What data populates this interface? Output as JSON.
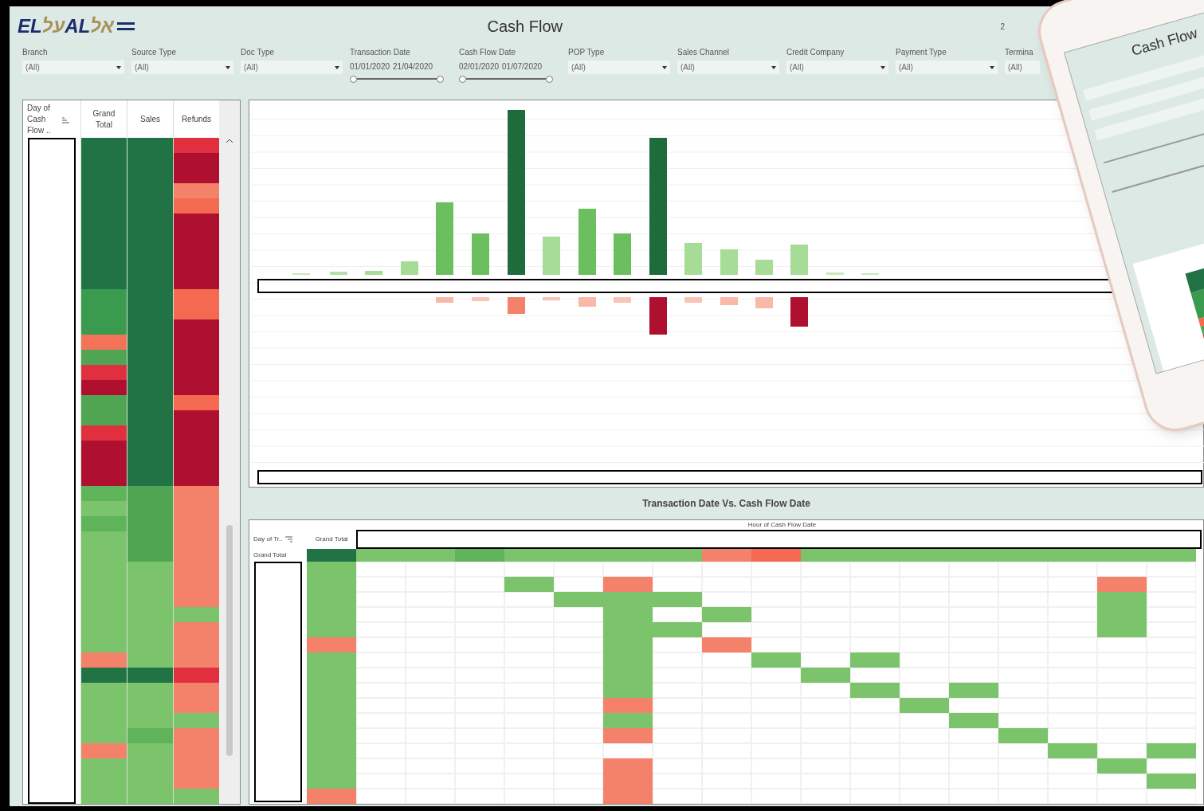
{
  "logo": {
    "latin_1": "EL",
    "hebrew_1": "על",
    "latin_2": "AL",
    "hebrew_2": "אל"
  },
  "title": "Cash Flow",
  "corner_text": "2",
  "filters": [
    {
      "kind": "dropdown",
      "label": "Branch",
      "value": "(All)"
    },
    {
      "kind": "dropdown",
      "label": "Source Type",
      "value": "(All)"
    },
    {
      "kind": "dropdown",
      "label": "Doc Type",
      "value": "(All)"
    },
    {
      "kind": "range",
      "label": "Transaction Date",
      "start": "01/01/2020",
      "end": "21/04/2020",
      "level": 1
    },
    {
      "kind": "range",
      "label": "Cash Flow Date",
      "start": "02/01/2020",
      "end": "01/07/2020",
      "level": 1
    },
    {
      "kind": "dropdown",
      "label": "POP Type",
      "value": "(All)"
    },
    {
      "kind": "dropdown",
      "label": "Sales Channel",
      "value": "(All)"
    },
    {
      "kind": "dropdown",
      "label": "Credit Company",
      "value": "(All)"
    },
    {
      "kind": "dropdown",
      "label": "Payment Type",
      "value": "(All)"
    },
    {
      "kind": "partial",
      "label": "Termina",
      "value": "(All)"
    }
  ],
  "day_table": {
    "columns": [
      "Day of Cash Flow ..",
      "Grand Total",
      "Sales",
      "Refunds"
    ],
    "rows": [
      {
        "cells": [
          {
            "color": "#217346"
          },
          {
            "color": "#217346"
          },
          {
            "color": "#e03040"
          }
        ]
      },
      {
        "cells": [
          {
            "color": "#217346"
          },
          {
            "color": "#217346"
          },
          {
            "color": "#b01030"
          }
        ]
      },
      {
        "cells": [
          {
            "color": "#217346"
          },
          {
            "color": "#217346"
          },
          {
            "color": "#b01030"
          }
        ]
      },
      {
        "cells": [
          {
            "color": "#217346"
          },
          {
            "color": "#217346"
          },
          {
            "color": "#f4826a"
          }
        ]
      },
      {
        "cells": [
          {
            "color": "#217346"
          },
          {
            "color": "#217346"
          },
          {
            "color": "#f46a50"
          }
        ]
      },
      {
        "cells": [
          {
            "color": "#217346"
          },
          {
            "color": "#217346"
          },
          {
            "color": "#b01030"
          }
        ]
      },
      {
        "cells": [
          {
            "color": "#217346"
          },
          {
            "color": "#217346"
          },
          {
            "color": "#b01030"
          }
        ]
      },
      {
        "cells": [
          {
            "color": "#217346"
          },
          {
            "color": "#217346"
          },
          {
            "color": "#b01030"
          }
        ]
      },
      {
        "cells": [
          {
            "color": "#217346"
          },
          {
            "color": "#217346"
          },
          {
            "color": "#b01030"
          }
        ]
      },
      {
        "cells": [
          {
            "color": "#217346"
          },
          {
            "color": "#217346"
          },
          {
            "color": "#b01030"
          }
        ]
      },
      {
        "cells": [
          {
            "color": "#3a9a4d"
          },
          {
            "color": "#217346"
          },
          {
            "color": "#f46a50"
          }
        ]
      },
      {
        "cells": [
          {
            "color": "#3a9a4d"
          },
          {
            "color": "#217346"
          },
          {
            "color": "#f46a50"
          }
        ]
      },
      {
        "cells": [
          {
            "color": "#3a9a4d"
          },
          {
            "color": "#217346"
          },
          {
            "color": "#b01030"
          }
        ]
      },
      {
        "cells": [
          {
            "color": "#f4715a"
          },
          {
            "color": "#217346"
          },
          {
            "color": "#b01030"
          }
        ]
      },
      {
        "cells": [
          {
            "color": "#4fa552"
          },
          {
            "color": "#217346"
          },
          {
            "color": "#b01030"
          }
        ]
      },
      {
        "cells": [
          {
            "color": "#e03040"
          },
          {
            "color": "#217346"
          },
          {
            "color": "#b01030"
          }
        ]
      },
      {
        "cells": [
          {
            "color": "#b01030"
          },
          {
            "color": "#217346"
          },
          {
            "color": "#b01030"
          }
        ]
      },
      {
        "cells": [
          {
            "color": "#4fa552"
          },
          {
            "color": "#217346"
          },
          {
            "color": "#f46a50"
          }
        ]
      },
      {
        "cells": [
          {
            "color": "#4fa552"
          },
          {
            "color": "#217346"
          },
          {
            "color": "#b01030"
          }
        ]
      },
      {
        "cells": [
          {
            "color": "#e03040"
          },
          {
            "color": "#217346"
          },
          {
            "color": "#b01030"
          }
        ]
      },
      {
        "cells": [
          {
            "color": "#b01030"
          },
          {
            "color": "#217346"
          },
          {
            "color": "#b01030"
          }
        ]
      },
      {
        "cells": [
          {
            "color": "#b01030"
          },
          {
            "color": "#217346"
          },
          {
            "color": "#b01030"
          }
        ]
      },
      {
        "cells": [
          {
            "color": "#b01030"
          },
          {
            "color": "#217346"
          },
          {
            "color": "#b01030"
          }
        ]
      },
      {
        "cells": [
          {
            "color": "#5fb35a"
          },
          {
            "color": "#4fa552"
          },
          {
            "color": "#f4826a"
          }
        ]
      },
      {
        "cells": [
          {
            "color": "#7cc46b"
          },
          {
            "color": "#4fa552"
          },
          {
            "color": "#f4826a"
          }
        ]
      },
      {
        "cells": [
          {
            "color": "#5fb35a"
          },
          {
            "color": "#4fa552"
          },
          {
            "color": "#f4826a"
          }
        ]
      },
      {
        "cells": [
          {
            "color": "#7cc46b"
          },
          {
            "color": "#4fa552"
          },
          {
            "color": "#f4826a"
          }
        ]
      },
      {
        "cells": [
          {
            "color": "#7cc46b"
          },
          {
            "color": "#4fa552"
          },
          {
            "color": "#f4826a"
          }
        ]
      },
      {
        "cells": [
          {
            "color": "#7cc46b"
          },
          {
            "color": "#7cc46b"
          },
          {
            "color": "#f4826a"
          }
        ]
      },
      {
        "cells": [
          {
            "color": "#7cc46b"
          },
          {
            "color": "#7cc46b"
          },
          {
            "color": "#f4826a"
          }
        ]
      },
      {
        "cells": [
          {
            "color": "#7cc46b"
          },
          {
            "color": "#7cc46b"
          },
          {
            "color": "#f4826a"
          }
        ]
      },
      {
        "cells": [
          {
            "color": "#7cc46b"
          },
          {
            "color": "#7cc46b"
          },
          {
            "color": "#7cc46b"
          }
        ]
      },
      {
        "cells": [
          {
            "color": "#7cc46b"
          },
          {
            "color": "#7cc46b"
          },
          {
            "color": "#f4826a"
          }
        ]
      },
      {
        "cells": [
          {
            "color": "#7cc46b"
          },
          {
            "color": "#7cc46b"
          },
          {
            "color": "#f4826a"
          }
        ]
      },
      {
        "cells": [
          {
            "color": "#f4826a"
          },
          {
            "color": "#7cc46b"
          },
          {
            "color": "#f4826a"
          }
        ]
      },
      {
        "cells": [
          {
            "color": "#217346"
          },
          {
            "color": "#217346"
          },
          {
            "color": "#e03040"
          }
        ]
      },
      {
        "cells": [
          {
            "color": "#7cc46b"
          },
          {
            "color": "#7cc46b"
          },
          {
            "color": "#f4826a"
          }
        ]
      },
      {
        "cells": [
          {
            "color": "#7cc46b"
          },
          {
            "color": "#7cc46b"
          },
          {
            "color": "#f4826a"
          }
        ]
      },
      {
        "cells": [
          {
            "color": "#7cc46b"
          },
          {
            "color": "#7cc46b"
          },
          {
            "color": "#7cc46b"
          }
        ]
      },
      {
        "cells": [
          {
            "color": "#7cc46b"
          },
          {
            "color": "#5fb35a"
          },
          {
            "color": "#f4826a"
          }
        ]
      },
      {
        "cells": [
          {
            "color": "#f4826a"
          },
          {
            "color": "#7cc46b"
          },
          {
            "color": "#f4826a"
          }
        ]
      },
      {
        "cells": [
          {
            "color": "#7cc46b"
          },
          {
            "color": "#7cc46b"
          },
          {
            "color": "#f4826a"
          }
        ]
      },
      {
        "cells": [
          {
            "color": "#7cc46b"
          },
          {
            "color": "#7cc46b"
          },
          {
            "color": "#f4826a"
          }
        ]
      },
      {
        "cells": [
          {
            "color": "#7cc46b"
          },
          {
            "color": "#7cc46b"
          },
          {
            "color": "#7cc46b"
          }
        ]
      }
    ]
  },
  "matrix": {
    "title": "Transaction Date Vs. Cash Flow Date",
    "row_header": "Day of Tr..",
    "total_header": "Grand Total",
    "column_header": "Hour of Cash Flow Date",
    "total_row_label": "Grand Total",
    "total_row": {
      "total": {
        "color": "#217346"
      },
      "cells": [
        {
          "filled": true,
          "color": "#7cc46b"
        },
        {
          "filled": true,
          "color": "#7cc46b"
        },
        {
          "filled": true,
          "color": "#5fb35a"
        },
        {
          "filled": true,
          "color": "#7cc46b"
        },
        {
          "filled": true,
          "color": "#7cc46b"
        },
        {
          "filled": true,
          "color": "#7cc46b"
        },
        {
          "filled": true,
          "color": "#7cc46b"
        },
        {
          "filled": true,
          "color": "#f4826a"
        },
        {
          "filled": true,
          "color": "#f46a50"
        },
        {
          "filled": true,
          "color": "#7cc46b"
        },
        {
          "filled": true,
          "color": "#7cc46b"
        },
        {
          "filled": true,
          "color": "#7cc46b"
        },
        {
          "filled": true,
          "color": "#7cc46b"
        },
        {
          "filled": true,
          "color": "#7cc46b"
        },
        {
          "filled": true,
          "color": "#7cc46b"
        },
        {
          "filled": true,
          "color": "#7cc46b"
        },
        {
          "filled": true,
          "color": "#7cc46b"
        }
      ]
    },
    "rows": [
      {
        "total": {
          "color": "#7cc46b"
        },
        "cells": [
          {
            "filled": false
          },
          {
            "filled": false
          },
          {
            "filled": false
          },
          {
            "filled": false
          },
          {
            "filled": false
          },
          {
            "filled": false
          },
          {
            "filled": false
          },
          {
            "filled": false
          },
          {
            "filled": false
          },
          {
            "filled": false
          },
          {
            "filled": false
          },
          {
            "filled": false
          },
          {
            "filled": false
          },
          {
            "filled": false
          },
          {
            "filled": false
          },
          {
            "filled": false
          },
          {
            "filled": false
          }
        ]
      },
      {
        "total": {
          "color": "#7cc46b"
        },
        "cells": [
          {
            "filled": false
          },
          {
            "filled": false
          },
          {
            "filled": false
          },
          {
            "filled": true,
            "color": "#7cc46b"
          },
          {
            "filled": false
          },
          {
            "filled": true,
            "color": "#f4826a"
          },
          {
            "filled": false
          },
          {
            "filled": false
          },
          {
            "filled": false
          },
          {
            "filled": false
          },
          {
            "filled": false
          },
          {
            "filled": false
          },
          {
            "filled": false
          },
          {
            "filled": false
          },
          {
            "filled": false
          },
          {
            "filled": true,
            "color": "#f4826a"
          },
          {
            "filled": false
          }
        ]
      },
      {
        "total": {
          "color": "#7cc46b"
        },
        "cells": [
          {
            "filled": false
          },
          {
            "filled": false
          },
          {
            "filled": false
          },
          {
            "filled": false
          },
          {
            "filled": true,
            "color": "#7cc46b"
          },
          {
            "filled": true,
            "color": "#7cc46b"
          },
          {
            "filled": true,
            "color": "#7cc46b"
          },
          {
            "filled": false
          },
          {
            "filled": false
          },
          {
            "filled": false
          },
          {
            "filled": false
          },
          {
            "filled": false
          },
          {
            "filled": false
          },
          {
            "filled": false
          },
          {
            "filled": false
          },
          {
            "filled": true,
            "color": "#7cc46b"
          },
          {
            "filled": false
          }
        ]
      },
      {
        "total": {
          "color": "#7cc46b"
        },
        "cells": [
          {
            "filled": false
          },
          {
            "filled": false
          },
          {
            "filled": false
          },
          {
            "filled": false
          },
          {
            "filled": false
          },
          {
            "filled": true,
            "color": "#7cc46b"
          },
          {
            "filled": false
          },
          {
            "filled": true,
            "color": "#7cc46b"
          },
          {
            "filled": false
          },
          {
            "filled": false
          },
          {
            "filled": false
          },
          {
            "filled": false
          },
          {
            "filled": false
          },
          {
            "filled": false
          },
          {
            "filled": false
          },
          {
            "filled": true,
            "color": "#7cc46b"
          },
          {
            "filled": false
          }
        ]
      },
      {
        "total": {
          "color": "#7cc46b"
        },
        "cells": [
          {
            "filled": false
          },
          {
            "filled": false
          },
          {
            "filled": false
          },
          {
            "filled": false
          },
          {
            "filled": false
          },
          {
            "filled": true,
            "color": "#7cc46b"
          },
          {
            "filled": true,
            "color": "#7cc46b"
          },
          {
            "filled": false
          },
          {
            "filled": false
          },
          {
            "filled": false
          },
          {
            "filled": false
          },
          {
            "filled": false
          },
          {
            "filled": false
          },
          {
            "filled": false
          },
          {
            "filled": false
          },
          {
            "filled": true,
            "color": "#7cc46b"
          },
          {
            "filled": false
          }
        ]
      },
      {
        "total": {
          "color": "#f4826a"
        },
        "cells": [
          {
            "filled": false
          },
          {
            "filled": false
          },
          {
            "filled": false
          },
          {
            "filled": false
          },
          {
            "filled": false
          },
          {
            "filled": true,
            "color": "#7cc46b"
          },
          {
            "filled": false
          },
          {
            "filled": true,
            "color": "#f4826a"
          },
          {
            "filled": false
          },
          {
            "filled": false
          },
          {
            "filled": false
          },
          {
            "filled": false
          },
          {
            "filled": false
          },
          {
            "filled": false
          },
          {
            "filled": false
          },
          {
            "filled": false
          },
          {
            "filled": false
          }
        ]
      },
      {
        "total": {
          "color": "#7cc46b"
        },
        "cells": [
          {
            "filled": false
          },
          {
            "filled": false
          },
          {
            "filled": false
          },
          {
            "filled": false
          },
          {
            "filled": false
          },
          {
            "filled": true,
            "color": "#7cc46b"
          },
          {
            "filled": false
          },
          {
            "filled": false
          },
          {
            "filled": true,
            "color": "#7cc46b"
          },
          {
            "filled": false
          },
          {
            "filled": true,
            "color": "#7cc46b"
          },
          {
            "filled": false
          },
          {
            "filled": false
          },
          {
            "filled": false
          },
          {
            "filled": false
          },
          {
            "filled": false
          },
          {
            "filled": false
          }
        ]
      },
      {
        "total": {
          "color": "#7cc46b"
        },
        "cells": [
          {
            "filled": false
          },
          {
            "filled": false
          },
          {
            "filled": false
          },
          {
            "filled": false
          },
          {
            "filled": false
          },
          {
            "filled": true,
            "color": "#7cc46b"
          },
          {
            "filled": false
          },
          {
            "filled": false
          },
          {
            "filled": false
          },
          {
            "filled": true,
            "color": "#7cc46b"
          },
          {
            "filled": false
          },
          {
            "filled": false
          },
          {
            "filled": false
          },
          {
            "filled": false
          },
          {
            "filled": false
          },
          {
            "filled": false
          },
          {
            "filled": false
          }
        ]
      },
      {
        "total": {
          "color": "#7cc46b"
        },
        "cells": [
          {
            "filled": false
          },
          {
            "filled": false
          },
          {
            "filled": false
          },
          {
            "filled": false
          },
          {
            "filled": false
          },
          {
            "filled": true,
            "color": "#7cc46b"
          },
          {
            "filled": false
          },
          {
            "filled": false
          },
          {
            "filled": false
          },
          {
            "filled": false
          },
          {
            "filled": true,
            "color": "#7cc46b"
          },
          {
            "filled": false
          },
          {
            "filled": true,
            "color": "#7cc46b"
          },
          {
            "filled": false
          },
          {
            "filled": false
          },
          {
            "filled": false
          },
          {
            "filled": false
          }
        ]
      },
      {
        "total": {
          "color": "#7cc46b"
        },
        "cells": [
          {
            "filled": false
          },
          {
            "filled": false
          },
          {
            "filled": false
          },
          {
            "filled": false
          },
          {
            "filled": false
          },
          {
            "filled": true,
            "color": "#f4826a"
          },
          {
            "filled": false
          },
          {
            "filled": false
          },
          {
            "filled": false
          },
          {
            "filled": false
          },
          {
            "filled": false
          },
          {
            "filled": true,
            "color": "#7cc46b"
          },
          {
            "filled": false
          },
          {
            "filled": false
          },
          {
            "filled": false
          },
          {
            "filled": false
          },
          {
            "filled": false
          }
        ]
      },
      {
        "total": {
          "color": "#7cc46b"
        },
        "cells": [
          {
            "filled": false
          },
          {
            "filled": false
          },
          {
            "filled": false
          },
          {
            "filled": false
          },
          {
            "filled": false
          },
          {
            "filled": true,
            "color": "#7cc46b"
          },
          {
            "filled": false
          },
          {
            "filled": false
          },
          {
            "filled": false
          },
          {
            "filled": false
          },
          {
            "filled": false
          },
          {
            "filled": false
          },
          {
            "filled": true,
            "color": "#7cc46b"
          },
          {
            "filled": false
          },
          {
            "filled": false
          },
          {
            "filled": false
          },
          {
            "filled": false
          }
        ]
      },
      {
        "total": {
          "color": "#7cc46b"
        },
        "cells": [
          {
            "filled": false
          },
          {
            "filled": false
          },
          {
            "filled": false
          },
          {
            "filled": false
          },
          {
            "filled": false
          },
          {
            "filled": true,
            "color": "#f4826a"
          },
          {
            "filled": false
          },
          {
            "filled": false
          },
          {
            "filled": false
          },
          {
            "filled": false
          },
          {
            "filled": false
          },
          {
            "filled": false
          },
          {
            "filled": false
          },
          {
            "filled": true,
            "color": "#7cc46b"
          },
          {
            "filled": false
          },
          {
            "filled": false
          },
          {
            "filled": false
          }
        ]
      },
      {
        "total": {
          "color": "#7cc46b"
        },
        "cells": [
          {
            "filled": false
          },
          {
            "filled": false
          },
          {
            "filled": false
          },
          {
            "filled": false
          },
          {
            "filled": false
          },
          {
            "filled": false
          },
          {
            "filled": false
          },
          {
            "filled": false
          },
          {
            "filled": false
          },
          {
            "filled": false
          },
          {
            "filled": false
          },
          {
            "filled": false
          },
          {
            "filled": false
          },
          {
            "filled": false
          },
          {
            "filled": true,
            "color": "#7cc46b"
          },
          {
            "filled": false
          },
          {
            "filled": true,
            "color": "#7cc46b"
          }
        ]
      },
      {
        "total": {
          "color": "#7cc46b"
        },
        "cells": [
          {
            "filled": false
          },
          {
            "filled": false
          },
          {
            "filled": false
          },
          {
            "filled": false
          },
          {
            "filled": false
          },
          {
            "filled": true,
            "color": "#f4826a"
          },
          {
            "filled": false
          },
          {
            "filled": false
          },
          {
            "filled": false
          },
          {
            "filled": false
          },
          {
            "filled": false
          },
          {
            "filled": false
          },
          {
            "filled": false
          },
          {
            "filled": false
          },
          {
            "filled": false
          },
          {
            "filled": true,
            "color": "#7cc46b"
          },
          {
            "filled": false
          }
        ]
      },
      {
        "total": {
          "color": "#7cc46b"
        },
        "cells": [
          {
            "filled": false
          },
          {
            "filled": false
          },
          {
            "filled": false
          },
          {
            "filled": false
          },
          {
            "filled": false
          },
          {
            "filled": true,
            "color": "#f4826a"
          },
          {
            "filled": false
          },
          {
            "filled": false
          },
          {
            "filled": false
          },
          {
            "filled": false
          },
          {
            "filled": false
          },
          {
            "filled": false
          },
          {
            "filled": false
          },
          {
            "filled": false
          },
          {
            "filled": false
          },
          {
            "filled": false
          },
          {
            "filled": true,
            "color": "#7cc46b"
          }
        ]
      },
      {
        "total": {
          "color": "#f4826a"
        },
        "cells": [
          {
            "filled": false
          },
          {
            "filled": false
          },
          {
            "filled": false
          },
          {
            "filled": false
          },
          {
            "filled": false
          },
          {
            "filled": true,
            "color": "#f4826a"
          },
          {
            "filled": false
          },
          {
            "filled": false
          },
          {
            "filled": false
          },
          {
            "filled": false
          },
          {
            "filled": false
          },
          {
            "filled": false
          },
          {
            "filled": false
          },
          {
            "filled": false
          },
          {
            "filled": false
          },
          {
            "filled": false
          },
          {
            "filled": false
          }
        ]
      }
    ]
  },
  "phone": {
    "title": "Cash Flow"
  }
}
